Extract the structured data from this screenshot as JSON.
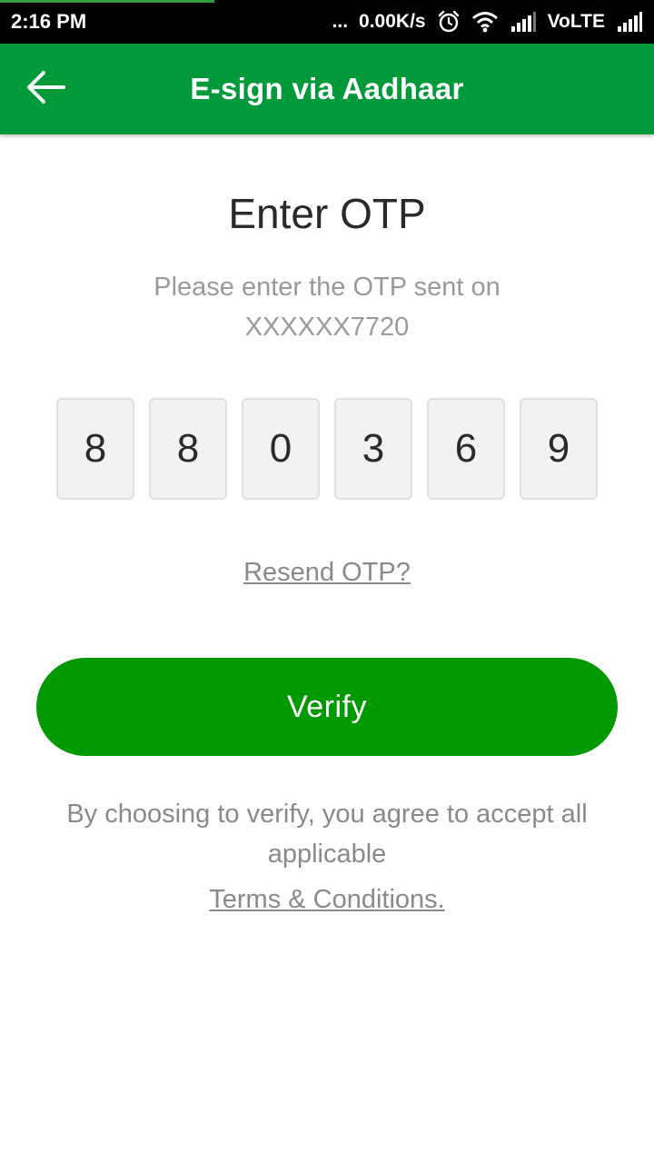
{
  "status_bar": {
    "time": "2:16 PM",
    "dots": "...",
    "network_speed": "0.00K/s",
    "volte": "VoLTE",
    "icons": [
      "alarm-icon",
      "wifi-icon",
      "signal-icon",
      "signal-icon"
    ]
  },
  "app_bar": {
    "title": "E-sign via Aadhaar",
    "back_icon": "arrow-left-icon",
    "color": "#009a3a"
  },
  "content": {
    "heading": "Enter OTP",
    "subtext_line1": "Please enter the OTP sent on",
    "subtext_line2": "XXXXXX7720",
    "otp_digits": [
      "8",
      "8",
      "0",
      "3",
      "6",
      "9"
    ],
    "resend_label": "Resend OTP?",
    "verify_label": "Verify",
    "verify_color": "#009a00",
    "disclaimer_line1": "By choosing to verify, you agree to accept all",
    "disclaimer_line2": "applicable",
    "terms_label": "Terms & Conditions."
  }
}
